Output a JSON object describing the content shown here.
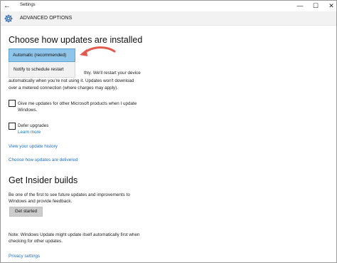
{
  "titlebar": {
    "title": "Settings",
    "back_glyph": "←",
    "minimize_glyph": "—",
    "maximize_glyph": "☐",
    "close_glyph": "✕"
  },
  "header": {
    "title": "ADVANCED OPTIONS",
    "icon": "gear-icon"
  },
  "section_install": {
    "heading": "Choose how updates are installed",
    "dropdown_selected": "Automatic (recommended)",
    "dropdown_option": "Notify to schedule restart",
    "desc_line1": "thly. We'll restart your device",
    "desc_line2": "automatically when you're not using it. Updates won't download",
    "desc_line3": "over a metered connection (where charges may apply)."
  },
  "checkboxes": {
    "ms_products_line1": "Give me updates for other Microsoft products when I update",
    "ms_products_line2": "Windows.",
    "defer": "Defer upgrades",
    "learn_more": "Learn more"
  },
  "links": {
    "history": "View your update history",
    "delivered": "Choose how updates are delivered"
  },
  "section_insider": {
    "heading": "Get Insider builds",
    "text_line1": "Be one of the first to see future updates and improvements to",
    "text_line2": "Windows and provide feedback.",
    "button": "Get started"
  },
  "note": {
    "line1": "Note: Windows Update might update itself automatically first when",
    "line2": "checking for other updates."
  },
  "privacy": "Privacy settings",
  "colors": {
    "accent": "#1d6fc3",
    "selected_bg": "#8fc5ea",
    "annotation_arrow": "#e05a4e"
  }
}
